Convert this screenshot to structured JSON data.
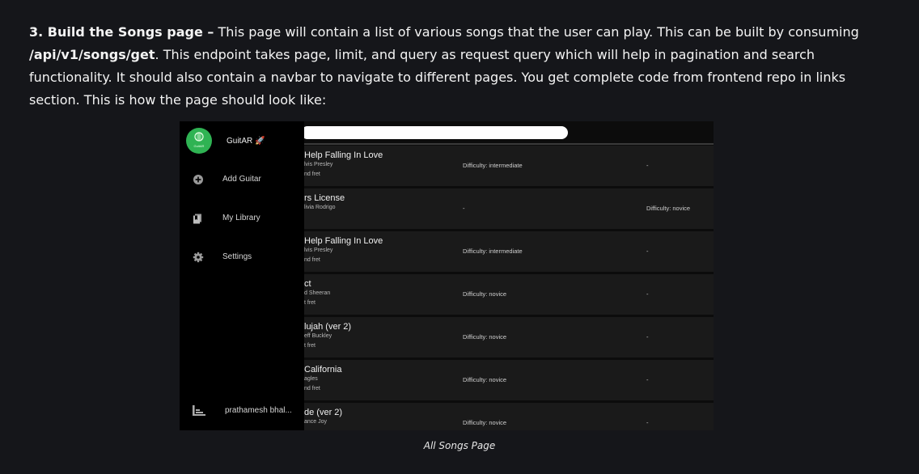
{
  "paragraph": {
    "step_label": "3. Build the Songs page –",
    "text_1": " This page will contain a list of various songs that the user can play. This can be built by consuming ",
    "endpoint": "/api/v1/songs/get",
    "text_2": ". This endpoint takes page, limit, and query as request query which will help in pagination and search functionality. It should also contain a navbar to navigate to different pages. You get complete code from frontend repo in links section. This is how the page should look like:"
  },
  "screenshot": {
    "brand": "GuitAR 🚀",
    "logo_text": "GuitAR",
    "nav": [
      {
        "label": "Add Guitar",
        "icon": "plus-circle-icon"
      },
      {
        "label": "My Library",
        "icon": "library-icon"
      },
      {
        "label": "Settings",
        "icon": "gear-icon"
      }
    ],
    "user": "prathamesh bhal...",
    "songs": [
      {
        "title": "Help Falling In Love",
        "artist": "lvis Presley",
        "fret": "nd fret",
        "c2": "Difficulty: intermediate",
        "c3": "-"
      },
      {
        "title": "rs License",
        "artist": "livia Rodrigo",
        "fret": "",
        "c2": "-",
        "c3": "Difficulty: novice"
      },
      {
        "title": "Help Falling In Love",
        "artist": "lvis Presley",
        "fret": "nd fret",
        "c2": "Difficulty: intermediate",
        "c3": "-"
      },
      {
        "title": "ct",
        "artist": "d Sheeran",
        "fret": "t fret",
        "c2": "Difficulty: novice",
        "c3": "-"
      },
      {
        "title": "lujah (ver 2)",
        "artist": "eff Buckley",
        "fret": "t fret",
        "c2": "Difficulty: novice",
        "c3": "-"
      },
      {
        "title": " California",
        "artist": "agles",
        "fret": "nd fret",
        "c2": "Difficulty: novice",
        "c3": "-"
      },
      {
        "title": "de (ver 2)",
        "artist": "ance Joy",
        "fret": "",
        "c2": "Difficulty: novice",
        "c3": "-"
      }
    ]
  },
  "caption": "All Songs Page"
}
